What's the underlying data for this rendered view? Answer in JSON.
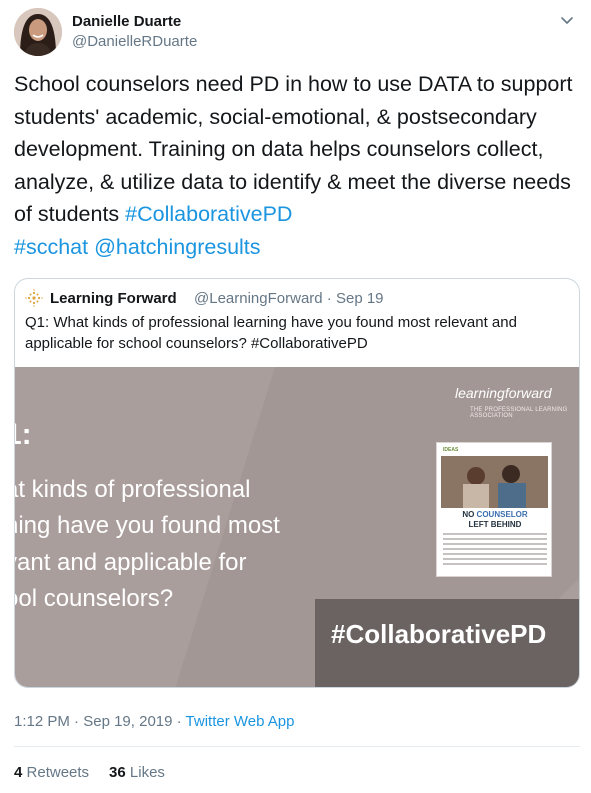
{
  "author": {
    "name": "Danielle Duarte",
    "handle": "@DanielleRDuarte"
  },
  "tweet": {
    "text_main": "School counselors need PD in how to use DATA to support students' academic, social-emotional, & postsecondary development. Training on data helps counselors collect, analyze, & utilize data to identify & meet the diverse needs of students ",
    "link_hashtag1": "#CollaborativePD",
    "link_hashtag2": "#scchat",
    "link_mention": "@hatchingresults"
  },
  "quoted": {
    "name": "Learning Forward",
    "handle": "@LearningForward",
    "date": "Sep 19",
    "text": "Q1: What kinds of professional learning have you found most relevant and applicable for school counselors? #CollaborativePD",
    "media": {
      "question_title": "1:",
      "question_lines": [
        "at kinds of professional",
        "ning have you found most",
        "vant and applicable for",
        "ool counselors?"
      ],
      "hashtag": "#CollaborativePD",
      "brand": "learningforward",
      "tagline": "THE PROFESSIONAL LEARNING ASSOCIATION",
      "magazine_label": "IDEAS",
      "magazine_title_1": "NO",
      "magazine_title_2": "COUNSELOR",
      "magazine_title_3": "LEFT BEHIND"
    }
  },
  "meta": {
    "time": "1:12 PM",
    "date": "Sep 19, 2019",
    "separator": "·",
    "app": "Twitter Web App"
  },
  "stats": {
    "retweets_count": "4",
    "retweets_label": "Retweets",
    "likes_count": "36",
    "likes_label": "Likes"
  },
  "colors": {
    "link": "#1b95e0",
    "secondary_text": "#657786",
    "media_bg": "#aa9e9c",
    "media_dark": "#6b6362"
  }
}
